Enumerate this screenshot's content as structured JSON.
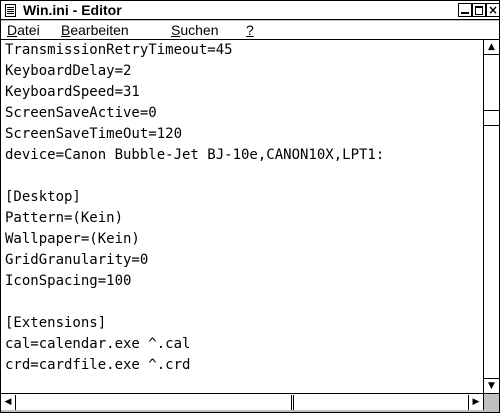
{
  "window": {
    "title": "Win.ini - Editor",
    "close_glyph": "×"
  },
  "menu": [
    {
      "prefix": "",
      "accel": "D",
      "rest": "atei"
    },
    {
      "prefix": "",
      "accel": "B",
      "rest": "earbeiten"
    },
    {
      "prefix": "",
      "accel": "S",
      "rest": "uchen"
    },
    {
      "prefix": "",
      "accel": "?",
      "rest": ""
    }
  ],
  "lines": [
    "TransmissionRetryTimeout=45",
    "KeyboardDelay=2",
    "KeyboardSpeed=31",
    "ScreenSaveActive=0",
    "ScreenSaveTimeOut=120",
    "device=Canon Bubble-Jet BJ-10e,CANON10X,LPT1:",
    "",
    "[Desktop]",
    "Pattern=(Kein)",
    "Wallpaper=(Kein)",
    "GridGranularity=0",
    "IconSpacing=100",
    "",
    "[Extensions]",
    "cal=calendar.exe ^.cal",
    "crd=cardfile.exe ^.crd"
  ],
  "scroll": {
    "up_glyph": "▲",
    "down_glyph": "▼",
    "left_glyph": "◀",
    "right_glyph": "▶"
  }
}
